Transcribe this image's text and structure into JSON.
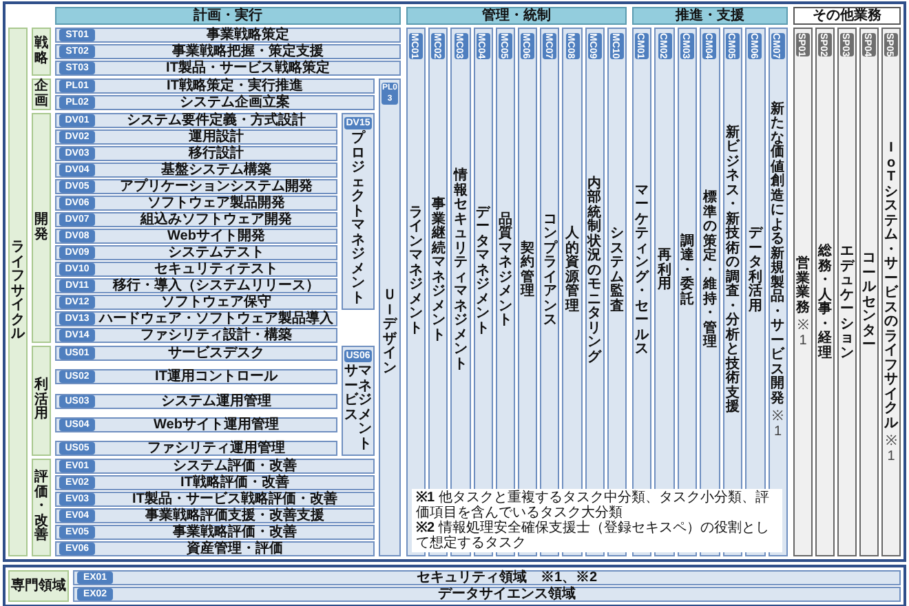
{
  "plan_execute": {
    "header": "計画・実行",
    "lifecycle_label": "ライフサイクル",
    "phases": [
      {
        "label": "戦略",
        "kind": "full",
        "tasks": [
          {
            "id": "ST01",
            "name": "事業戦略策定"
          },
          {
            "id": "ST02",
            "name": "事業戦略把握・策定支援"
          },
          {
            "id": "ST03",
            "name": "IT製品・サービス戦略策定"
          }
        ]
      },
      {
        "label": "企画",
        "kind": "wide",
        "tasks": [
          {
            "id": "PL01",
            "name": "IT戦略策定・実行推進"
          },
          {
            "id": "PL02",
            "name": "システム企画立案"
          }
        ]
      },
      {
        "label": "開発",
        "kind": "side",
        "side": {
          "id": "DV15",
          "lines": [
            "プロジェクトマネジメント"
          ]
        },
        "tasks": [
          {
            "id": "DV01",
            "name": "システム要件定義・方式設計"
          },
          {
            "id": "DV02",
            "name": "運用設計"
          },
          {
            "id": "DV03",
            "name": "移行設計"
          },
          {
            "id": "DV04",
            "name": "基盤システム構築"
          },
          {
            "id": "DV05",
            "name": "アプリケーションシステム開発"
          },
          {
            "id": "DV06",
            "name": "ソフトウェア製品開発"
          },
          {
            "id": "DV07",
            "name": "組込みソフトウェア開発"
          },
          {
            "id": "DV08",
            "name": "Webサイト開発"
          },
          {
            "id": "DV09",
            "name": "システムテスト"
          },
          {
            "id": "DV10",
            "name": "セキュリティテスト"
          },
          {
            "id": "DV11",
            "name": "移行・導入（システムリリース）"
          },
          {
            "id": "DV12",
            "name": "ソフトウェア保守"
          },
          {
            "id": "DV13",
            "name": "ハードウェア・ソフトウェア製品導入"
          },
          {
            "id": "DV14",
            "name": "ファシリティ設計・構築"
          }
        ]
      },
      {
        "label": "利活用",
        "kind": "side",
        "side": {
          "id": "US06",
          "lines": [
            "サービス",
            "マネジメント"
          ]
        },
        "tasks": [
          {
            "id": "US01",
            "name": "サービスデスク"
          },
          {
            "id": "US02",
            "name": "IT運用コントロール"
          },
          {
            "id": "US03",
            "name": "システム運用管理"
          },
          {
            "id": "US04",
            "name": "Webサイト運用管理"
          },
          {
            "id": "US05",
            "name": "ファシリティ運用管理"
          }
        ]
      },
      {
        "label": "評価・改善",
        "kind": "wide",
        "tasks": [
          {
            "id": "EV01",
            "name": "システム評価・改善"
          },
          {
            "id": "EV02",
            "name": "IT戦略評価・改善"
          },
          {
            "id": "EV03",
            "name": "IT製品・サービス戦略評価・改善"
          },
          {
            "id": "EV04",
            "name": "事業戦略評価支援・改善支援"
          },
          {
            "id": "EV05",
            "name": "事業戦略評価・改善"
          },
          {
            "id": "EV06",
            "name": "資産管理・評価"
          }
        ]
      }
    ],
    "cross_column": {
      "id": "PL03",
      "label": "ＵＩデザイン"
    }
  },
  "sections": [
    {
      "header": "管理・統制",
      "kind": "core",
      "columns": [
        {
          "id": "MC01",
          "label": "ラインマネジメント"
        },
        {
          "id": "MC02",
          "label": "事業継続マネジメント"
        },
        {
          "id": "MC03",
          "label": "情報セキュリティマネジメント"
        },
        {
          "id": "MC04",
          "label": "データマネジメント"
        },
        {
          "id": "MC05",
          "label": "品質マネジメント"
        },
        {
          "id": "MC06",
          "label": "契約管理"
        },
        {
          "id": "MC07",
          "label": "コンプライアンス"
        },
        {
          "id": "MC08",
          "label": "人的資源管理"
        },
        {
          "id": "MC09",
          "label": "内部統制状況のモニタリング"
        },
        {
          "id": "MC10",
          "label": "システム監査"
        }
      ]
    },
    {
      "header": "推進・支援",
      "kind": "core",
      "columns": [
        {
          "id": "CM01",
          "label": "マーケティング・セールス"
        },
        {
          "id": "CM02",
          "label": "再利用"
        },
        {
          "id": "CM03",
          "label": "調達・委託"
        },
        {
          "id": "CM04",
          "label": "標準の策定・維持・管理"
        },
        {
          "id": "CM05",
          "label": "新ビジネス・新技術の調査・分析と技術支援"
        },
        {
          "id": "CM06",
          "label": "データ利活用"
        },
        {
          "id": "CM07",
          "label": "新たな価値創造による新規製品・サービス開発",
          "note": "※1"
        }
      ]
    },
    {
      "header": "その他業務",
      "kind": "other",
      "columns": [
        {
          "id": "SP01",
          "label": "営業業務",
          "note": "※1"
        },
        {
          "id": "SP02",
          "label": "総務・人事・経理"
        },
        {
          "id": "SP03",
          "label": "エデュケーション"
        },
        {
          "id": "SP04",
          "label": "コールセンター"
        },
        {
          "id": "SP05",
          "label": "IoTシステム・サービスのライフサイクル",
          "note": "※1"
        }
      ]
    }
  ],
  "footnotes": [
    "**※1** 他タスクと重複するタスク中分類、タスク小分類、評価項目を含んでいるタスク大分類",
    "**※2** 情報処理安全確保支援士（登録セキスペ）の役割として想定するタスク"
  ],
  "specialized": {
    "label": "専門領域",
    "tasks": [
      {
        "id": "EX01",
        "name": "セキュリティ領域　※1、※2"
      },
      {
        "id": "EX02",
        "name": "データサイエンス領域"
      }
    ]
  }
}
